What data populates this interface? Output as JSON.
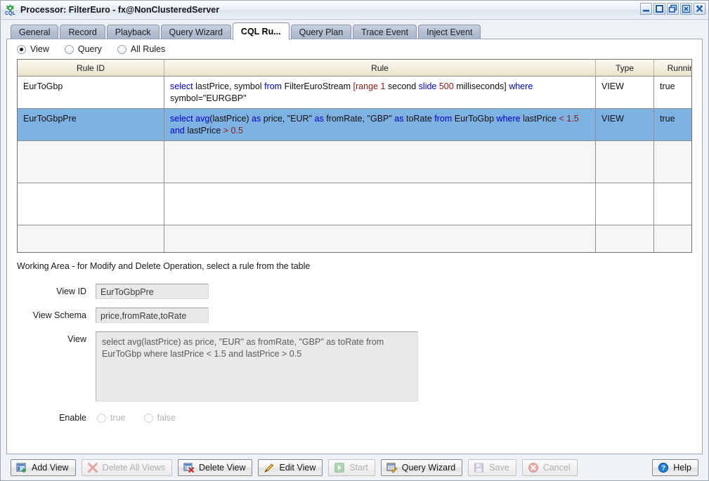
{
  "window": {
    "title": "Processor: FilterEuro - fx@NonClusteredServer",
    "icon": "cql-gear-icon",
    "controls": [
      {
        "name": "minimize-button",
        "icon": "minimize-icon"
      },
      {
        "name": "maximize-button",
        "icon": "maximize-icon"
      },
      {
        "name": "restore-button",
        "icon": "restore-icon"
      },
      {
        "name": "close-tab-button",
        "icon": "close-box-icon"
      },
      {
        "name": "close-window-button",
        "icon": "close-icon"
      }
    ]
  },
  "tabs": [
    {
      "label": "General",
      "active": false
    },
    {
      "label": "Record",
      "active": false
    },
    {
      "label": "Playback",
      "active": false
    },
    {
      "label": "Query Wizard",
      "active": false
    },
    {
      "label": "CQL Ru...",
      "active": true
    },
    {
      "label": "Query Plan",
      "active": false
    },
    {
      "label": "Trace Event",
      "active": false
    },
    {
      "label": "Inject Event",
      "active": false
    }
  ],
  "filter": {
    "options": [
      {
        "label": "View",
        "checked": true
      },
      {
        "label": "Query",
        "checked": false
      },
      {
        "label": "All Rules",
        "checked": false
      }
    ]
  },
  "table": {
    "columns": [
      "Rule ID",
      "Rule",
      "Type",
      "Running"
    ],
    "rows": [
      {
        "rule_id": "EurToGbp",
        "rule_plain": "select lastPrice, symbol from FilterEuroStream [range 1 second slide 500 milliseconds] where symbol=\"EURGBP\"",
        "rule_tokens": [
          {
            "t": "select ",
            "c": "kw"
          },
          {
            "t": "lastPrice, symbol ",
            "c": ""
          },
          {
            "t": "from ",
            "c": "kw"
          },
          {
            "t": "FilterEuroStream ",
            "c": ""
          },
          {
            "t": "[range ",
            "c": "num"
          },
          {
            "t": "1 ",
            "c": "num"
          },
          {
            "t": "second ",
            "c": ""
          },
          {
            "t": "slide ",
            "c": "kw"
          },
          {
            "t": "500 ",
            "c": "num"
          },
          {
            "t": "milliseconds] ",
            "c": ""
          },
          {
            "t": "where ",
            "c": "kw"
          },
          {
            "t": "symbol=\"EURGBP\"",
            "c": ""
          }
        ],
        "type": "VIEW",
        "running": "true",
        "selected": false
      },
      {
        "rule_id": "EurToGbpPre",
        "rule_plain": "select avg(lastPrice) as price, \"EUR\" as fromRate, \"GBP\" as toRate from EurToGbp where lastPrice < 1.5 and lastPrice > 0.5",
        "rule_tokens": [
          {
            "t": "select ",
            "c": "kw"
          },
          {
            "t": "avg",
            "c": "kw"
          },
          {
            "t": "(lastPrice) ",
            "c": ""
          },
          {
            "t": "as ",
            "c": "kw"
          },
          {
            "t": "price, \"EUR\" ",
            "c": ""
          },
          {
            "t": "as ",
            "c": "kw"
          },
          {
            "t": "fromRate, \"GBP\" ",
            "c": ""
          },
          {
            "t": "as ",
            "c": "kw"
          },
          {
            "t": "toRate ",
            "c": ""
          },
          {
            "t": "from ",
            "c": "kw"
          },
          {
            "t": "EurToGbp ",
            "c": ""
          },
          {
            "t": "where ",
            "c": "kw"
          },
          {
            "t": "lastPrice ",
            "c": ""
          },
          {
            "t": "< ",
            "c": "op"
          },
          {
            "t": "1.5 ",
            "c": "num"
          },
          {
            "t": "and ",
            "c": "kw"
          },
          {
            "t": "lastPrice ",
            "c": ""
          },
          {
            "t": "> ",
            "c": "op"
          },
          {
            "t": "0.5",
            "c": "num"
          }
        ],
        "type": "VIEW",
        "running": "true",
        "selected": true
      }
    ],
    "empty_row_count": 3
  },
  "working_area": {
    "heading": "Working Area - for Modify and Delete Operation, select a rule from the table",
    "fields": [
      {
        "label": "View ID",
        "value": "EurToGbpPre"
      },
      {
        "label": "View Schema",
        "value": "price,fromRate,toRate"
      }
    ],
    "view_label": "View",
    "view_value": "select avg(lastPrice) as price, \"EUR\" as fromRate, \"GBP\" as toRate from EurToGbp where lastPrice < 1.5 and lastPrice > 0.5",
    "enable_label": "Enable",
    "enable_options": [
      {
        "label": "true",
        "checked": false,
        "disabled": true
      },
      {
        "label": "false",
        "checked": false,
        "disabled": true
      }
    ]
  },
  "buttons": [
    {
      "label": "Add View",
      "icon": "add-view-icon",
      "disabled": false,
      "name": "add-view-button"
    },
    {
      "label": "Delete All Views",
      "icon": "delete-all-icon",
      "disabled": true,
      "name": "delete-all-views-button"
    },
    {
      "label": "Delete View",
      "icon": "delete-view-icon",
      "disabled": false,
      "name": "delete-view-button"
    },
    {
      "label": "Edit View",
      "icon": "pencil-icon",
      "disabled": false,
      "name": "edit-view-button"
    },
    {
      "label": "Start",
      "icon": "play-icon",
      "disabled": true,
      "name": "start-button"
    },
    {
      "label": "Query Wizard",
      "icon": "wizard-icon",
      "disabled": false,
      "name": "query-wizard-button"
    },
    {
      "label": "Save",
      "icon": "save-icon",
      "disabled": true,
      "name": "save-button"
    },
    {
      "label": "Cancel",
      "icon": "cancel-icon",
      "disabled": true,
      "name": "cancel-button"
    },
    {
      "label": "Help",
      "icon": "help-icon",
      "disabled": false,
      "name": "help-button"
    }
  ],
  "colors": {
    "selection": "#7db2e3",
    "keyword": "#0000cc",
    "literal": "#8b1a12",
    "header_bg": "#f2efdf"
  }
}
